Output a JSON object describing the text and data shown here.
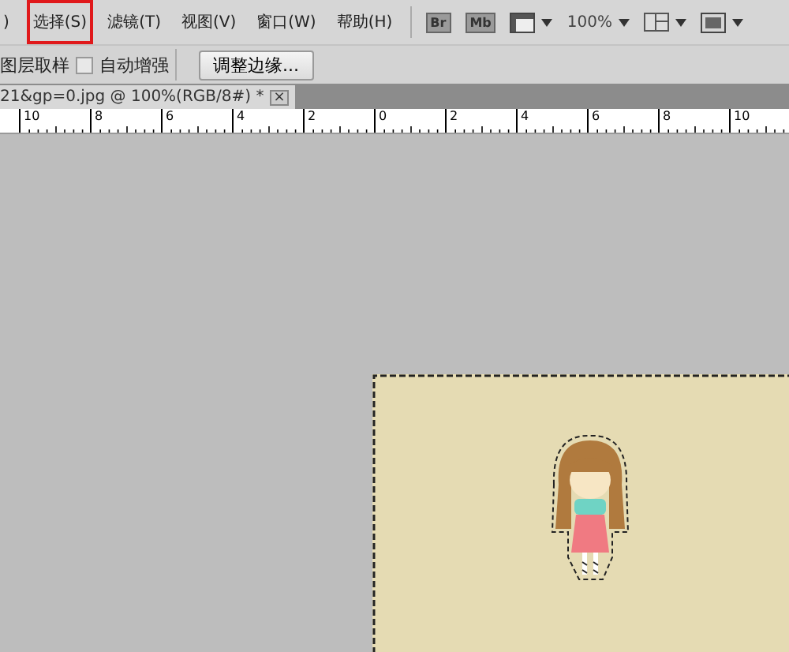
{
  "menu": [
    {
      "label": ")",
      "selected": false
    },
    {
      "label": "选择(S)",
      "selected": true
    },
    {
      "label": "滤镜(T)",
      "selected": false
    },
    {
      "label": "视图(V)",
      "selected": false
    },
    {
      "label": "窗口(W)",
      "selected": false
    },
    {
      "label": "帮助(H)",
      "selected": false
    }
  ],
  "app_buttons": [
    {
      "kind": "badge",
      "label": "Br"
    },
    {
      "kind": "badge",
      "label": "Mb"
    },
    {
      "kind": "view"
    },
    {
      "kind": "zoom",
      "label": "100%"
    },
    {
      "kind": "arrange"
    },
    {
      "kind": "screen"
    }
  ],
  "options": {
    "sample_label": "图层取样",
    "auto_enhance": {
      "label": "自动增强",
      "checked": false
    },
    "refine_button": "调整边缘..."
  },
  "document_tab": {
    "title": "21&gp=0.jpg @ 100%(RGB/8#) *",
    "close": "×"
  },
  "ruler": [
    "10",
    "8",
    "6",
    "4",
    "2",
    "0",
    "2",
    "4",
    "6",
    "8",
    "10"
  ]
}
